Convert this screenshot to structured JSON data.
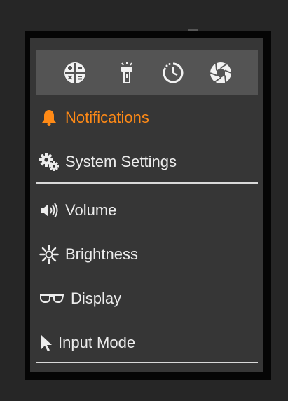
{
  "toolbar": {
    "icons": [
      "calculator-icon",
      "flashlight-icon",
      "timer-icon",
      "camera-shutter-icon"
    ]
  },
  "menu": {
    "notifications": {
      "label": "Notifications",
      "icon": "bell-icon",
      "color": "#ff8a16"
    },
    "system_settings": {
      "label": "System Settings",
      "icon": "gears-icon"
    },
    "volume": {
      "label": "Volume",
      "icon": "speaker-icon"
    },
    "brightness": {
      "label": "Brightness",
      "icon": "brightness-icon"
    },
    "display": {
      "label": "Display",
      "icon": "glasses-icon"
    },
    "input_mode": {
      "label": "Input Mode",
      "icon": "cursor-icon"
    }
  },
  "colors": {
    "accent": "#ff8a16",
    "panel": "#363636",
    "toolbar": "#545454",
    "text": "#ececec"
  }
}
